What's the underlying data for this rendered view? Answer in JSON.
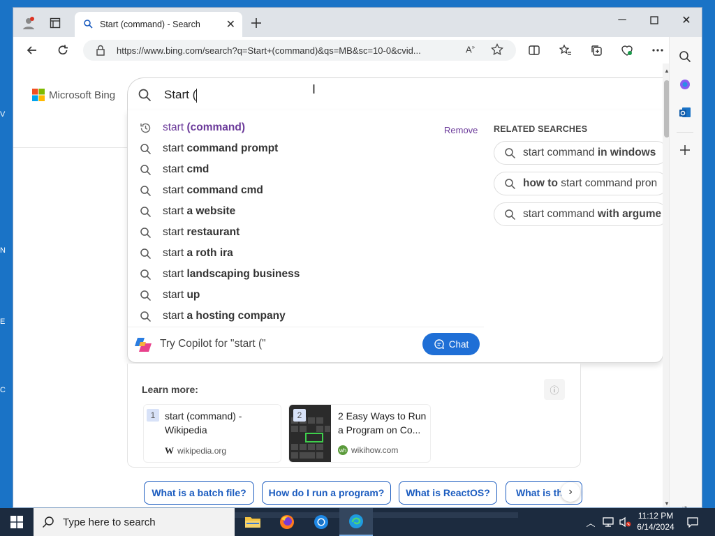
{
  "desktop": {
    "edge_letters": [
      "V",
      "N",
      "E",
      "C"
    ]
  },
  "browser": {
    "tab": {
      "title": "Start (command) - Search"
    },
    "address": {
      "url": "https://www.bing.com/search?q=Start+(command)&qs=MB&sc=10-0&cvid..."
    }
  },
  "bing": {
    "logo_text": "Microsoft Bing",
    "search_value": "Start (",
    "suggestions": [
      {
        "prefix": "start ",
        "bold": "(command)",
        "history": true
      },
      {
        "prefix": "start ",
        "bold": "command prompt"
      },
      {
        "prefix": "start ",
        "bold": "cmd"
      },
      {
        "prefix": "start ",
        "bold": "command cmd"
      },
      {
        "prefix": "start ",
        "bold": "a website"
      },
      {
        "prefix": "start ",
        "bold": "restaurant"
      },
      {
        "prefix": "start ",
        "bold": "a roth ira"
      },
      {
        "prefix": "start ",
        "bold": "landscaping business"
      },
      {
        "prefix": "start ",
        "bold": "up"
      },
      {
        "prefix": "start ",
        "bold": "a hosting company"
      }
    ],
    "remove_label": "Remove",
    "related_title": "RELATED SEARCHES",
    "related": [
      {
        "pre": "start command ",
        "bold": "in windows",
        "post": ""
      },
      {
        "pre": "",
        "bold": "how to",
        "post": " start command pron"
      },
      {
        "pre": "start command ",
        "bold": "with argume",
        "post": ""
      }
    ],
    "copilot_prompt": "Try Copilot for \"start (\"",
    "chat_label": "Chat",
    "learn_more": {
      "title": "Learn more:",
      "items": [
        {
          "num": "1",
          "title_line1": "start (command) -",
          "title_line2": "Wikipedia",
          "source": "wikipedia.org",
          "source_icon": "W"
        },
        {
          "num": "2",
          "title_line1": "2 Easy Ways to Run",
          "title_line2": "a Program on Co...",
          "source": "wikihow.com",
          "source_icon": "wh"
        }
      ]
    },
    "questions": [
      "What is a batch file?",
      "How do I run a program?",
      "What is ReactOS?",
      "What is th"
    ]
  },
  "taskbar": {
    "search_placeholder": "Type here to search",
    "time": "11:12 PM",
    "date": "6/14/2024"
  },
  "colors": {
    "accent": "#1f6fd6",
    "history": "#6b3a9a",
    "desktop": "#1a73c6",
    "taskbar": "#1c2b3f"
  }
}
